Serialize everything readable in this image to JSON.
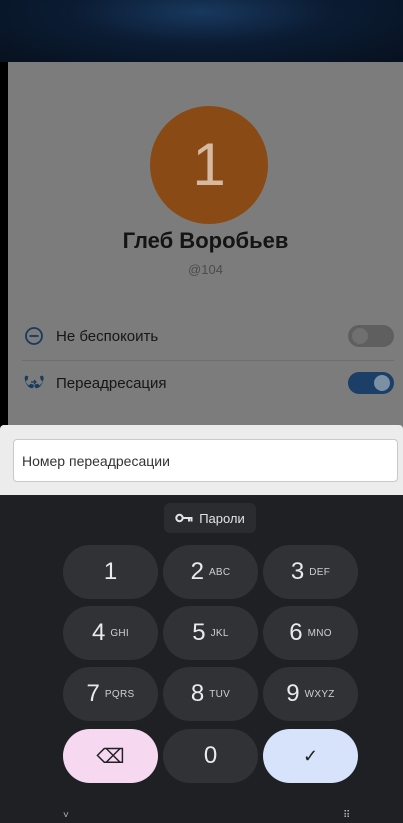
{
  "profile": {
    "avatar_text": "1",
    "avatar_color": "#8a4a15",
    "name": "Глеб Воробьев",
    "handle": "@104"
  },
  "settings": [
    {
      "label": "Не беспокоить",
      "icon": "minus-circle-icon",
      "enabled": false
    },
    {
      "label": "Переадресация",
      "icon": "call-forward-icon",
      "enabled": true
    }
  ],
  "forward_field": {
    "placeholder": "Номер переадресации",
    "value": ""
  },
  "keyboard": {
    "passwords_label": "Пароли",
    "keys": [
      {
        "digit": "1",
        "letters": ""
      },
      {
        "digit": "2",
        "letters": "ABC"
      },
      {
        "digit": "3",
        "letters": "DEF"
      },
      {
        "digit": "4",
        "letters": "GHI"
      },
      {
        "digit": "5",
        "letters": "JKL"
      },
      {
        "digit": "6",
        "letters": "MNO"
      },
      {
        "digit": "7",
        "letters": "PQRS"
      },
      {
        "digit": "8",
        "letters": "TUV"
      },
      {
        "digit": "9",
        "letters": "WXYZ"
      },
      {
        "digit": "0",
        "letters": ""
      }
    ],
    "delete_symbol": "⌫",
    "done_symbol": "✓"
  },
  "nav": {
    "left": "˅",
    "right": "⠿"
  }
}
